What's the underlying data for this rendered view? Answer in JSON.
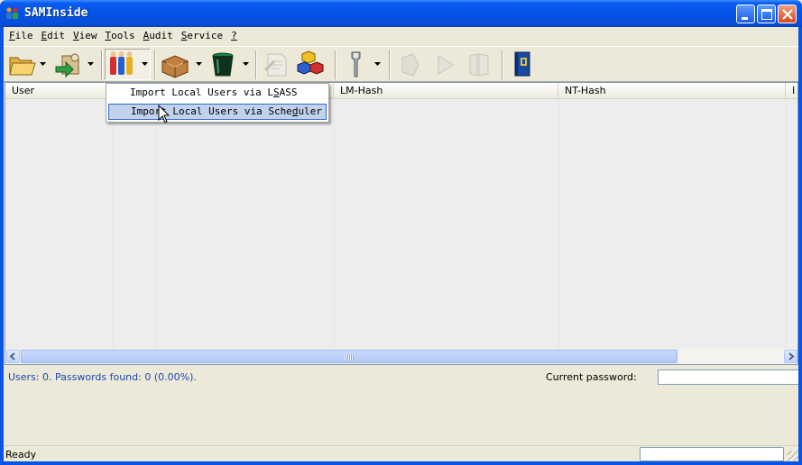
{
  "window": {
    "title": "SAMInside",
    "buttons": [
      "minimize",
      "maximize",
      "close"
    ]
  },
  "menubar": {
    "items": [
      {
        "ul": "F",
        "rest": "ile"
      },
      {
        "ul": "E",
        "rest": "dit"
      },
      {
        "ul": "V",
        "rest": "iew"
      },
      {
        "ul": "T",
        "rest": "ools"
      },
      {
        "ul": "A",
        "rest": "udit"
      },
      {
        "ul": "S",
        "rest": "ervice"
      },
      {
        "ul": "?",
        "rest": ""
      }
    ]
  },
  "toolbar": {
    "icons": [
      "open-folder-icon",
      "import-icon",
      "import-users-icon",
      "export-icon",
      "trash-icon",
      "document-icon",
      "cubes-icon",
      "wrench-icon",
      "audit-back-icon",
      "play-icon",
      "pause-icon",
      "help-book-icon"
    ]
  },
  "listview": {
    "columns": [
      "User",
      "",
      "",
      "LM-Hash",
      "NT-Hash",
      "I"
    ]
  },
  "popup": {
    "items": [
      {
        "before": "Import Local Users via L",
        "ul": "S",
        "after": "ASS"
      },
      {
        "before": "Import Local Users via Sche",
        "ul": "d",
        "after": "uler"
      }
    ]
  },
  "info": {
    "summary": "Users: 0. Passwords found: 0 (0.00%).",
    "current_password_label": "Current password:",
    "current_password_value": ""
  },
  "status": {
    "text": "Ready"
  },
  "colors": {
    "titlebar": "#0553e6",
    "face": "#ece9d8",
    "info_text": "#1c48b0",
    "menu_selection": "#c1d2ee"
  }
}
